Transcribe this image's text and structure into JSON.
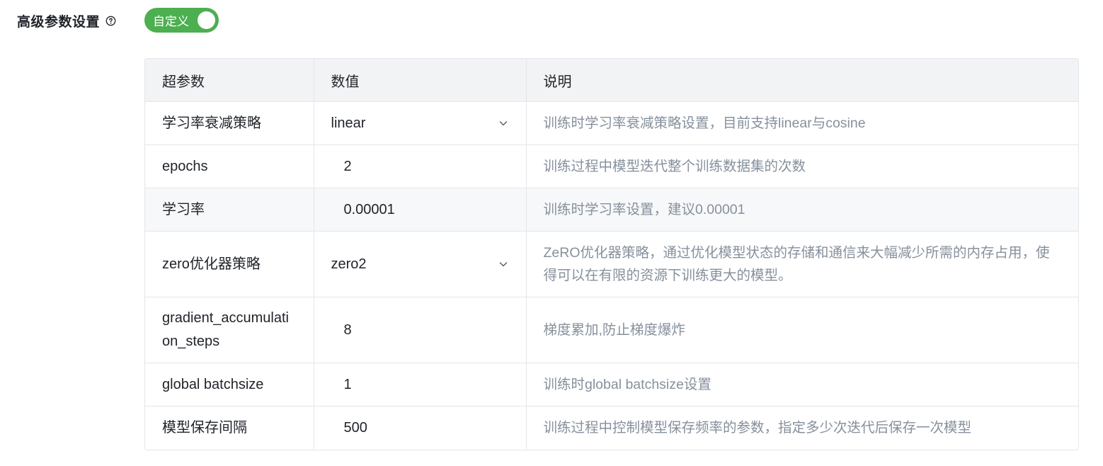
{
  "header": {
    "title": "高级参数设置",
    "help_icon": "question-circle-icon"
  },
  "toggle": {
    "label": "自定义",
    "state": "on",
    "color": "#4caf50"
  },
  "table": {
    "columns": [
      "超参数",
      "数值",
      "说明"
    ],
    "rows": [
      {
        "name": "学习率衰减策略",
        "value": "linear",
        "type": "select",
        "desc": "训练时学习率衰减策略设置，目前支持linear与cosine"
      },
      {
        "name": "epochs",
        "value": "2",
        "type": "input",
        "desc": "训练过程中模型迭代整个训练数据集的次数"
      },
      {
        "name": "学习率",
        "value": "0.00001",
        "type": "input",
        "desc": "训练时学习率设置，建议0.00001"
      },
      {
        "name": "zero优化器策略",
        "value": "zero2",
        "type": "select",
        "desc": "ZeRO优化器策略，通过优化模型状态的存储和通信来大幅减少所需的内存占用，使得可以在有限的资源下训练更大的模型。"
      },
      {
        "name": "gradient_accumulation_steps",
        "value": "8",
        "type": "input",
        "desc": "梯度累加,防止梯度爆炸"
      },
      {
        "name": "global batchsize",
        "value": "1",
        "type": "input",
        "desc": "训练时global batchsize设置"
      },
      {
        "name": "模型保存间隔",
        "value": "500",
        "type": "input",
        "desc": "训练过程中控制模型保存频率的参数，指定多少次迭代后保存一次模型"
      }
    ]
  }
}
